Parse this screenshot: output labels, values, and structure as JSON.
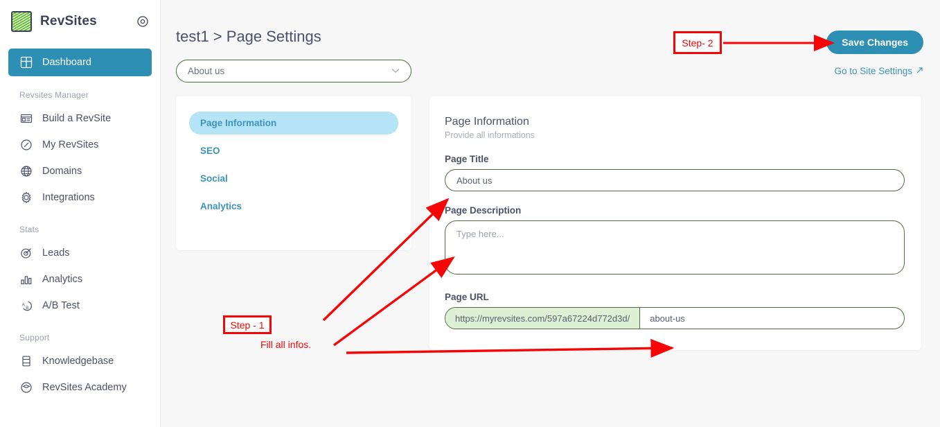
{
  "brand": {
    "name": "RevSites",
    "logo_icon": "revsites-logo-icon",
    "target_icon": "target-icon"
  },
  "sidebar": {
    "primary": [
      {
        "label": "Dashboard",
        "icon": "dashboard-grid-icon",
        "active": true
      }
    ],
    "groups": [
      {
        "title": "Revsites Manager",
        "items": [
          {
            "label": "Build a RevSite",
            "icon": "layout-browser-icon"
          },
          {
            "label": "My RevSites",
            "icon": "compass-icon"
          },
          {
            "label": "Domains",
            "icon": "globe-icon"
          },
          {
            "label": "Integrations",
            "icon": "gear-icon"
          }
        ]
      },
      {
        "title": "Stats",
        "items": [
          {
            "label": "Leads",
            "icon": "target-dart-icon"
          },
          {
            "label": "Analytics",
            "icon": "bar-chart-icon"
          },
          {
            "label": "A/B Test",
            "icon": "ab-test-icon"
          }
        ]
      },
      {
        "title": "Support",
        "items": [
          {
            "label": "Knowledgebase",
            "icon": "book-icon"
          },
          {
            "label": "RevSites Academy",
            "icon": "graduation-icon"
          }
        ]
      }
    ]
  },
  "header": {
    "breadcrumb": "test1 > Page Settings",
    "save_label": "Save Changes",
    "site_settings_label": "Go to Site Settings",
    "site_settings_icon": "external-link-arrow-icon"
  },
  "page_selector": {
    "value": "About us",
    "chevron_icon": "chevron-down-icon"
  },
  "tabs": [
    {
      "label": "Page Information",
      "active": true
    },
    {
      "label": "SEO",
      "active": false
    },
    {
      "label": "Social",
      "active": false
    },
    {
      "label": "Analytics",
      "active": false
    }
  ],
  "form": {
    "title": "Page Information",
    "subtitle": "Provide all informations",
    "page_title": {
      "label": "Page Title",
      "value": "About us",
      "placeholder": "About us"
    },
    "page_description": {
      "label": "Page Description",
      "value": "",
      "placeholder": "Type here..."
    },
    "page_url": {
      "label": "Page URL",
      "prefix": "https://myrevsites.com/597a67224d772d3d/",
      "value": "about-us",
      "placeholder": "about-us"
    }
  },
  "annotations": {
    "step2_label": "Step- 2",
    "step1_label": "Step - 1",
    "fill_note": "Fill all infos."
  },
  "colors": {
    "accent_teal": "#2e8fb5",
    "tab_active_bg": "#b5e4f7",
    "tab_link": "#3e93b8",
    "field_border_green": "#4e6b41",
    "url_prefix_bg": "#ddf0d4",
    "annotation_red": "#f50505",
    "sidebar_text": "#4b5169",
    "logo_green": "#62c22b"
  }
}
